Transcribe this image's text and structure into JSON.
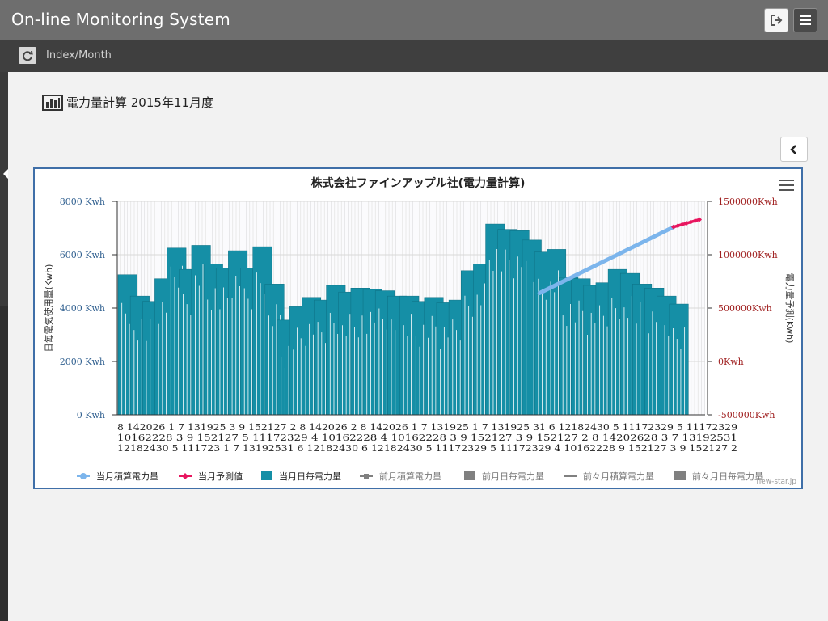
{
  "app": {
    "title": "On-line Monitoring System"
  },
  "toolbar": {
    "logout_icon": "sign-out-icon",
    "menu_icon": "hamburger-menu-icon"
  },
  "subbar": {
    "refresh_icon": "refresh-icon",
    "breadcrumb": "Index/Month"
  },
  "page": {
    "heading": "電力量計算 2015年11月度",
    "heading_icon": "bar-chart-icon"
  },
  "panel": {
    "collapse_icon": "chevron-left-icon"
  },
  "colors": {
    "accent_bar": "#158fa6",
    "cumulative_line": "#7cb5ec",
    "forecast_line": "#e8165f",
    "prev_gray": "#808080",
    "right_axis": "#a02020",
    "left_axis": "#2f5f8f"
  },
  "chart_data": {
    "type": "bar+line",
    "title": "株式会社ファインアップル社(電力量計算)",
    "ylabel": "日毎電気使用量(Kwh)",
    "ylabel_right": "電力量予測(Kwh)",
    "ylim": [
      0,
      8000
    ],
    "ylim_right": [
      -500000,
      1500000
    ],
    "left_ticks": [
      "8000 Kwh",
      "6000 Kwh",
      "4000 Kwh",
      "2000 Kwh",
      "0 Kwh"
    ],
    "right_ticks": [
      "1500000Kwh",
      "1000000Kwh",
      "500000Kwh",
      "0Kwh",
      "-500000Kwh"
    ],
    "x_labels_row1": "8  142026  1   7  131925  3   9  152127 2   8  142026  2   8  142026 1   7  131925  1   7  131925 31  6  12182430  5  11172329  5  11172329",
    "x_labels_row2": "10162228  3   9  152127  5  11172329 4  10162228  4  10162228  3   9  152127  3   9  152127  2   8  14202628  3   7  13192531",
    "x_labels_row3": "12182430  5  111723  1   7  13192531  6  12182430  6  12182430  5  11172329  5  11172329  4  10162228  9  152127  3   9  152127  2",
    "daily_values": [
      5250,
      4450,
      4250,
      5100,
      6250,
      5450,
      6350,
      5650,
      5500,
      6150,
      5500,
      6300,
      4900,
      3550,
      4050,
      4400,
      4300,
      4850,
      4600,
      4750,
      4700,
      4650,
      4450,
      4450,
      4250,
      4400,
      4200,
      4300,
      5400,
      5650,
      7150,
      6950,
      6900,
      6550,
      6100,
      6200,
      5150,
      5100,
      4850,
      4950,
      5450,
      5300,
      4900,
      4750,
      4450,
      4150
    ],
    "cumulative": {
      "name": "当月積算電力量",
      "start_index": 16,
      "start": 640000,
      "end_index": 31,
      "end": 1260000
    },
    "forecast": {
      "name": "当月予測値",
      "start": 1260000,
      "end": 1330000
    },
    "legend": [
      {
        "name": "当月積算電力量",
        "type": "line-dot",
        "color": "#7cb5ec",
        "active": true
      },
      {
        "name": "当月予測値",
        "type": "line-diamond",
        "color": "#e8165f",
        "active": true
      },
      {
        "name": "当月日毎電力量",
        "type": "bar",
        "color": "#158fa6",
        "active": true
      },
      {
        "name": "前月積算電力量",
        "type": "line-square",
        "color": "#808080",
        "active": false
      },
      {
        "name": "前月日毎電力量",
        "type": "bar",
        "color": "#808080",
        "active": false
      },
      {
        "name": "前々月積算電力量",
        "type": "line",
        "color": "#808080",
        "active": false
      },
      {
        "name": "前々月日毎電力量",
        "type": "bar",
        "color": "#808080",
        "active": false
      }
    ],
    "credit": "new-star.jp"
  }
}
